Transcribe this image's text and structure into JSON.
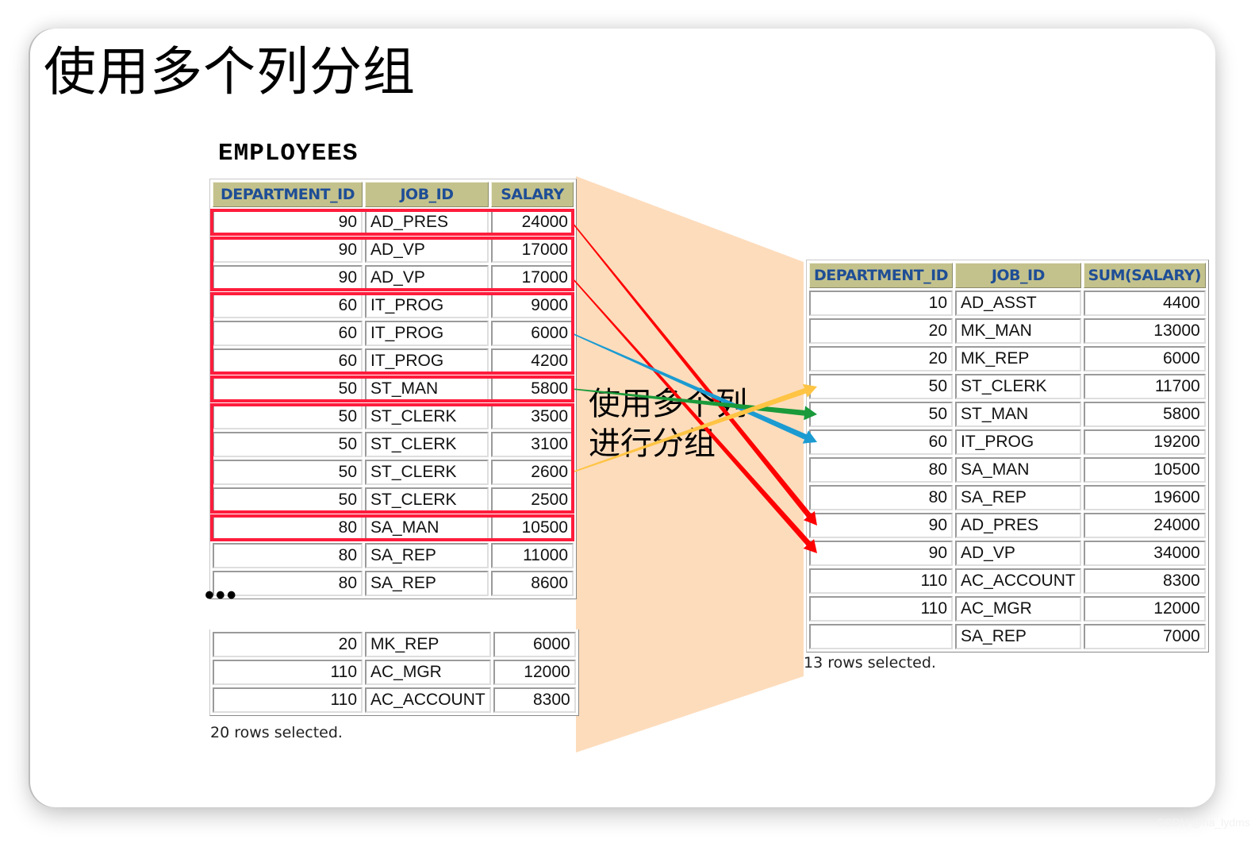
{
  "slide": {
    "title": "使用多个列分组",
    "source_table_name": "EMPLOYEES",
    "annotation_line1": "使用多个列",
    "annotation_line2": "进行分组",
    "ellipsis": "•••",
    "watermark": "CSDN @ha_lydms"
  },
  "colors": {
    "header_bg": "#c4c28c",
    "header_text": "#1f4e96",
    "group_box": "#ff1c3c",
    "funnel": "#fddcbc",
    "arrow_red": "#ff0000",
    "arrow_blue": "#1b9bd1",
    "arrow_green": "#1a9a3a",
    "arrow_yellow": "#ffc444"
  },
  "left_table": {
    "headers": [
      "DEPARTMENT_ID",
      "JOB_ID",
      "SALARY"
    ],
    "rows": [
      [
        "90",
        "AD_PRES",
        "24000"
      ],
      [
        "90",
        "AD_VP",
        "17000"
      ],
      [
        "90",
        "AD_VP",
        "17000"
      ],
      [
        "60",
        "IT_PROG",
        "9000"
      ],
      [
        "60",
        "IT_PROG",
        "6000"
      ],
      [
        "60",
        "IT_PROG",
        "4200"
      ],
      [
        "50",
        "ST_MAN",
        "5800"
      ],
      [
        "50",
        "ST_CLERK",
        "3500"
      ],
      [
        "50",
        "ST_CLERK",
        "3100"
      ],
      [
        "50",
        "ST_CLERK",
        "2600"
      ],
      [
        "50",
        "ST_CLERK",
        "2500"
      ],
      [
        "80",
        "SA_MAN",
        "10500"
      ],
      [
        "80",
        "SA_REP",
        "11000"
      ],
      [
        "80",
        "SA_REP",
        "8600"
      ]
    ],
    "tail_rows": [
      [
        "20",
        "MK_REP",
        "6000"
      ],
      [
        "110",
        "AC_MGR",
        "12000"
      ],
      [
        "110",
        "AC_ACCOUNT",
        "8300"
      ]
    ],
    "footer": "20 rows selected.",
    "groups": [
      {
        "rows": [
          0,
          0
        ],
        "label": "AD_PRES"
      },
      {
        "rows": [
          1,
          2
        ],
        "label": "AD_VP"
      },
      {
        "rows": [
          3,
          5
        ],
        "label": "IT_PROG"
      },
      {
        "rows": [
          6,
          6
        ],
        "label": "ST_MAN"
      },
      {
        "rows": [
          7,
          10
        ],
        "label": "ST_CLERK"
      },
      {
        "rows": [
          11,
          11
        ],
        "label": "SA_MAN"
      }
    ]
  },
  "right_table": {
    "headers": [
      "DEPARTMENT_ID",
      "JOB_ID",
      "SUM(SALARY)"
    ],
    "rows": [
      [
        "10",
        "AD_ASST",
        "4400"
      ],
      [
        "20",
        "MK_MAN",
        "13000"
      ],
      [
        "20",
        "MK_REP",
        "6000"
      ],
      [
        "50",
        "ST_CLERK",
        "11700"
      ],
      [
        "50",
        "ST_MAN",
        "5800"
      ],
      [
        "60",
        "IT_PROG",
        "19200"
      ],
      [
        "80",
        "SA_MAN",
        "10500"
      ],
      [
        "80",
        "SA_REP",
        "19600"
      ],
      [
        "90",
        "AD_PRES",
        "24000"
      ],
      [
        "90",
        "AD_VP",
        "34000"
      ],
      [
        "110",
        "AC_ACCOUNT",
        "8300"
      ],
      [
        "110",
        "AC_MGR",
        "12000"
      ],
      [
        "",
        "SA_REP",
        "7000"
      ]
    ],
    "footer": "13 rows selected."
  },
  "arrows": [
    {
      "from_left_row": 0,
      "to_right_row": 8,
      "color": "arrow_red"
    },
    {
      "from_left_row": 2,
      "to_right_row": 9,
      "color": "arrow_red"
    },
    {
      "from_left_row": 4,
      "to_right_row": 5,
      "color": "arrow_blue"
    },
    {
      "from_left_row": 6,
      "to_right_row": 4,
      "color": "arrow_green"
    },
    {
      "from_left_row": 9,
      "to_right_row": 3,
      "color": "arrow_yellow"
    }
  ]
}
